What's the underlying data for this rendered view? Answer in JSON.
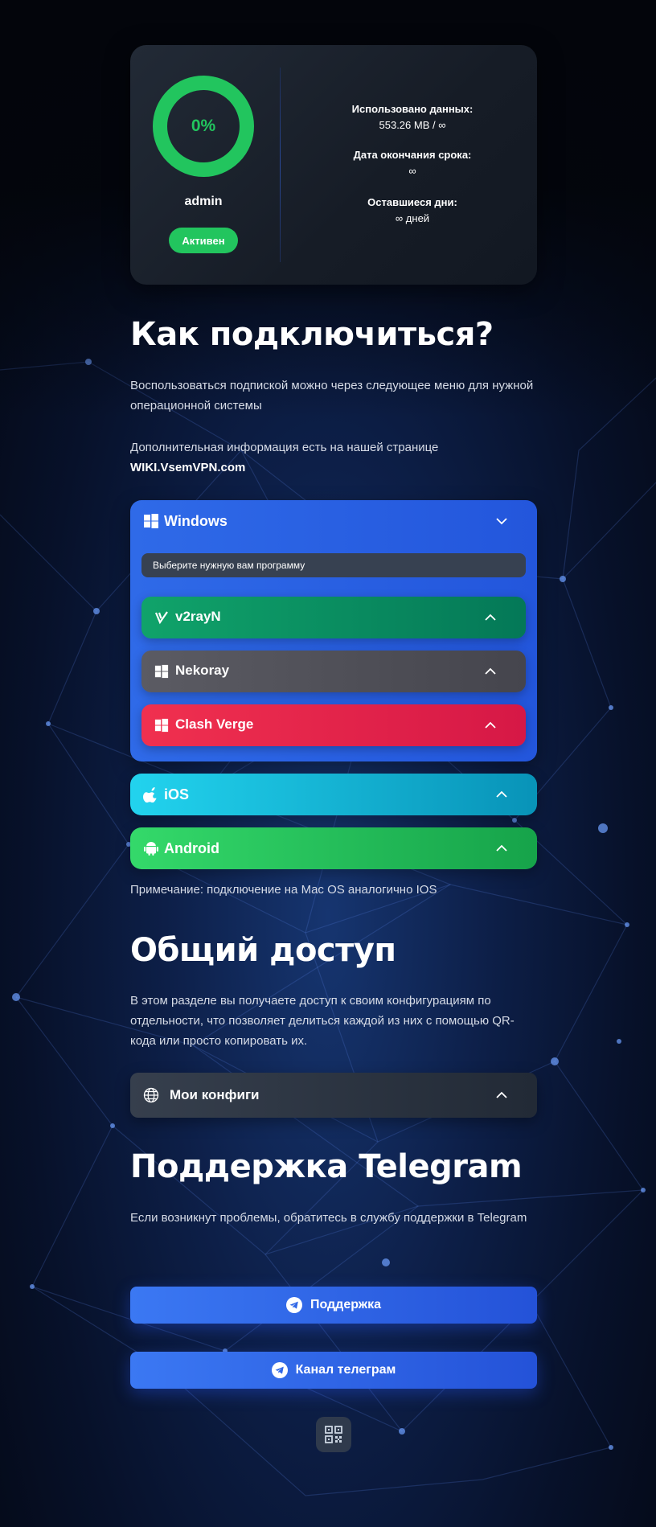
{
  "status": {
    "percent": "0%",
    "usage_fraction": 0,
    "username": "admin",
    "status_label": "Активен",
    "data_used_label": "Использовано данных:",
    "data_used_value": "553.26 MB / ∞",
    "expire_label": "Дата окончания срока:",
    "expire_value": "∞",
    "days_left_label": "Оставшиеся дни:",
    "days_left_value": "∞ дней"
  },
  "connect": {
    "title": "Как подключиться?",
    "desc": "Воспользоваться подпиской можно через следующее меню для нужной операционной системы",
    "wiki_text": "Дополнительная информация есть на нашей странице",
    "wiki_link": "WIKI.VsemVPN.com"
  },
  "platforms": {
    "windows": {
      "label": "Windows",
      "hint": "Выберите нужную вам программу",
      "apps": [
        "v2rayN",
        "Nekoray",
        "Clash Verge"
      ]
    },
    "ios": {
      "label": "iOS"
    },
    "android": {
      "label": "Android"
    },
    "note": "Примечание: подключение на Mac OS аналогично IOS"
  },
  "shared": {
    "title": "Общий доступ",
    "desc": "В этом разделе вы получаете доступ к своим конфигурациям по отдельности, что позволяет делиться каждой из них с помощью QR-кода или просто копировать их.",
    "configs_label": "Мои конфиги"
  },
  "support": {
    "title": "Поддержка Telegram",
    "desc": "Если возникнут проблемы, обратитесь в службу поддержки в Telegram",
    "support_button": "Поддержка",
    "channel_button": "Канал телеграм"
  },
  "icons": {
    "windows": "windows-icon",
    "v2rayn": "v2rayn-logo-icon",
    "apple": "apple-icon",
    "android": "android-icon",
    "globe": "globe-icon",
    "telegram": "telegram-icon",
    "qr": "qr-code-icon",
    "chevron_up": "chevron-up-icon",
    "chevron_down": "chevron-down-icon"
  },
  "colors": {
    "accent_green": "#22c55e",
    "windows_blue": "#2f6ae8",
    "v2rayn_green": "#059669",
    "nekoray_gray": "#52525b",
    "clash_red": "#e11d48",
    "ios_cyan": "#06b6d4",
    "android_green": "#22c55e",
    "button_blue": "#3b78f3"
  }
}
